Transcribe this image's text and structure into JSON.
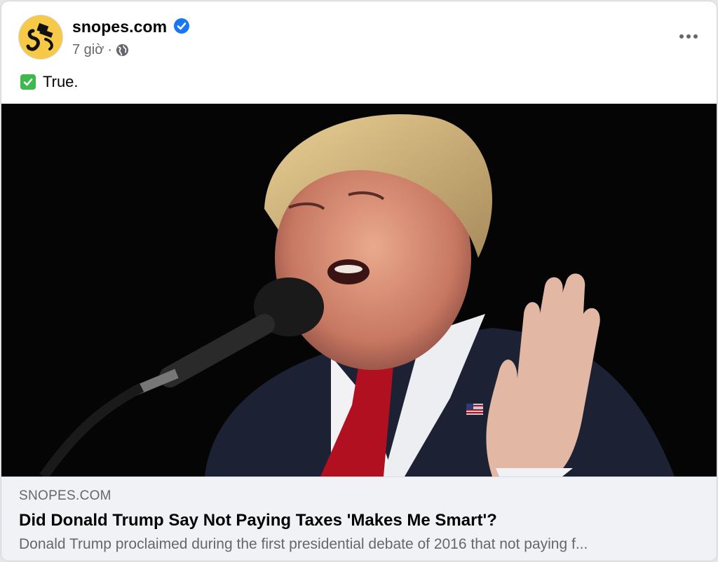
{
  "post": {
    "page_name": "snopes.com",
    "verified": true,
    "time": "7 giờ",
    "separator": "·",
    "audience_icon": "globe-icon",
    "more_icon": "more-options-icon",
    "text": "True.",
    "text_emoji": "check-mark-button-icon"
  },
  "photo": {
    "subject": "man speaking at a microphone"
  },
  "link": {
    "domain": "SNOPES.COM",
    "title": "Did Donald Trump Say Not Paying Taxes 'Makes Me Smart'?",
    "description": "Donald Trump proclaimed during the first presidential debate of 2016 that not paying f..."
  },
  "colors": {
    "verified_blue": "#1877f2",
    "avatar_yellow": "#f7c948",
    "secondary_text": "#65676b",
    "link_bg": "#f0f2f5",
    "check_green": "#3dba4e"
  }
}
